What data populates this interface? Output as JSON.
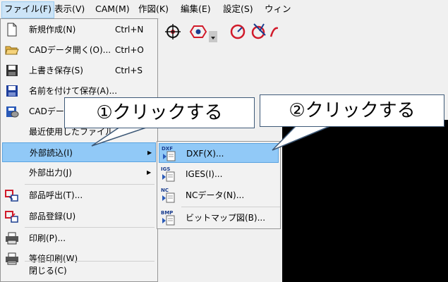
{
  "menubar": {
    "items": [
      "ファイル(F)",
      "表示(V)",
      "CAM(M)",
      "作図(K)",
      "編集(E)",
      "設定(S)",
      "ウィン"
    ]
  },
  "file_menu": {
    "items": [
      {
        "label": "新規作成(N)",
        "shortcut": "Ctrl+N",
        "icon": "new-file-icon"
      },
      {
        "label": "CADデータ開く(O)...",
        "shortcut": "Ctrl+O",
        "icon": "open-folder-icon"
      },
      {
        "label": "上書き保存(S)",
        "shortcut": "Ctrl+S",
        "icon": "save-icon"
      },
      {
        "label": "名前を付けて保存(A)...",
        "shortcut": "",
        "icon": "save-as-icon"
      },
      {
        "label": "CADデータ",
        "shortcut": "",
        "icon": "cad-data-icon"
      },
      {
        "label": "最近使用したファイル",
        "shortcut": "",
        "icon": ""
      },
      {
        "label": "外部読込(I)",
        "shortcut": "",
        "icon": "",
        "submenu": true
      },
      {
        "label": "外部出力(J)",
        "shortcut": "",
        "icon": "",
        "submenu": true
      },
      {
        "label": "部品呼出(T)...",
        "shortcut": "",
        "icon": "part-call-icon"
      },
      {
        "label": "部品登録(U)",
        "shortcut": "",
        "icon": "part-register-icon"
      },
      {
        "label": "印刷(P)...",
        "shortcut": "",
        "icon": "printer-icon"
      },
      {
        "label": "等倍印刷(W)",
        "shortcut": "",
        "icon": "printer-actual-size-icon"
      },
      {
        "label": "閉じる(C)",
        "shortcut": "",
        "icon": ""
      }
    ]
  },
  "import_submenu": {
    "items": [
      {
        "label": "DXF(X)...",
        "badge": "DXF"
      },
      {
        "label": "IGES(I)...",
        "badge": "IGS"
      },
      {
        "label": "NCデータ(N)...",
        "badge": "NC"
      },
      {
        "label": "ビットマップ図(B)...",
        "badge": "BMP"
      }
    ]
  },
  "callouts": {
    "first": "①クリックする",
    "second": "②クリックする"
  },
  "colors": {
    "highlight": "#91c9f7",
    "callout_border": "#3f5a78",
    "toolbar_red": "#d11a2a"
  }
}
